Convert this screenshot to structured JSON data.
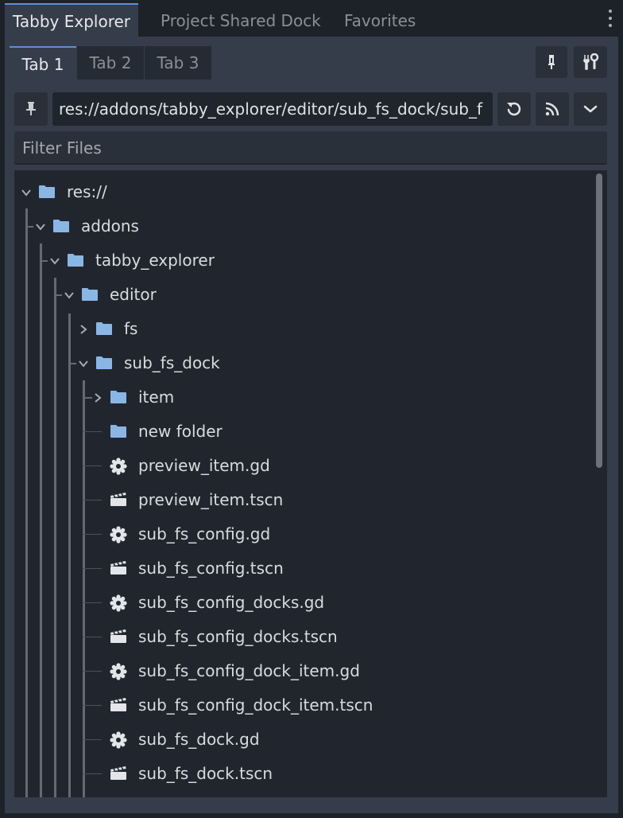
{
  "dock_tabs": [
    "Tabby Explorer",
    "Project Shared Dock",
    "Favorites"
  ],
  "sub_tabs": [
    "Tab 1",
    "Tab 2",
    "Tab 3"
  ],
  "path_field": {
    "value": "res://addons/tabby_explorer/editor/sub_fs_dock/sub_f"
  },
  "filter": {
    "placeholder": "Filter Files"
  },
  "tree": [
    {
      "label": "res://",
      "kind": "folder",
      "state": "expanded"
    },
    {
      "label": "addons",
      "kind": "folder",
      "state": "expanded"
    },
    {
      "label": "tabby_explorer",
      "kind": "folder",
      "state": "expanded"
    },
    {
      "label": "editor",
      "kind": "folder",
      "state": "expanded"
    },
    {
      "label": "fs",
      "kind": "folder",
      "state": "collapsed"
    },
    {
      "label": "sub_fs_dock",
      "kind": "folder",
      "state": "expanded"
    },
    {
      "label": "item",
      "kind": "folder",
      "state": "collapsed"
    },
    {
      "label": "new folder",
      "kind": "folder",
      "state": "empty"
    },
    {
      "label": "preview_item.gd",
      "kind": "script"
    },
    {
      "label": "preview_item.tscn",
      "kind": "scene"
    },
    {
      "label": "sub_fs_config.gd",
      "kind": "script"
    },
    {
      "label": "sub_fs_config.tscn",
      "kind": "scene"
    },
    {
      "label": "sub_fs_config_docks.gd",
      "kind": "script"
    },
    {
      "label": "sub_fs_config_docks.tscn",
      "kind": "scene"
    },
    {
      "label": "sub_fs_config_dock_item.gd",
      "kind": "script"
    },
    {
      "label": "sub_fs_config_dock_item.tscn",
      "kind": "scene"
    },
    {
      "label": "sub_fs_dock.gd",
      "kind": "script"
    },
    {
      "label": "sub_fs_dock.tscn",
      "kind": "scene"
    }
  ],
  "colors": {
    "accent": "#5e8ed6",
    "folder": "#8ab6e6",
    "background": "#363d4a"
  }
}
